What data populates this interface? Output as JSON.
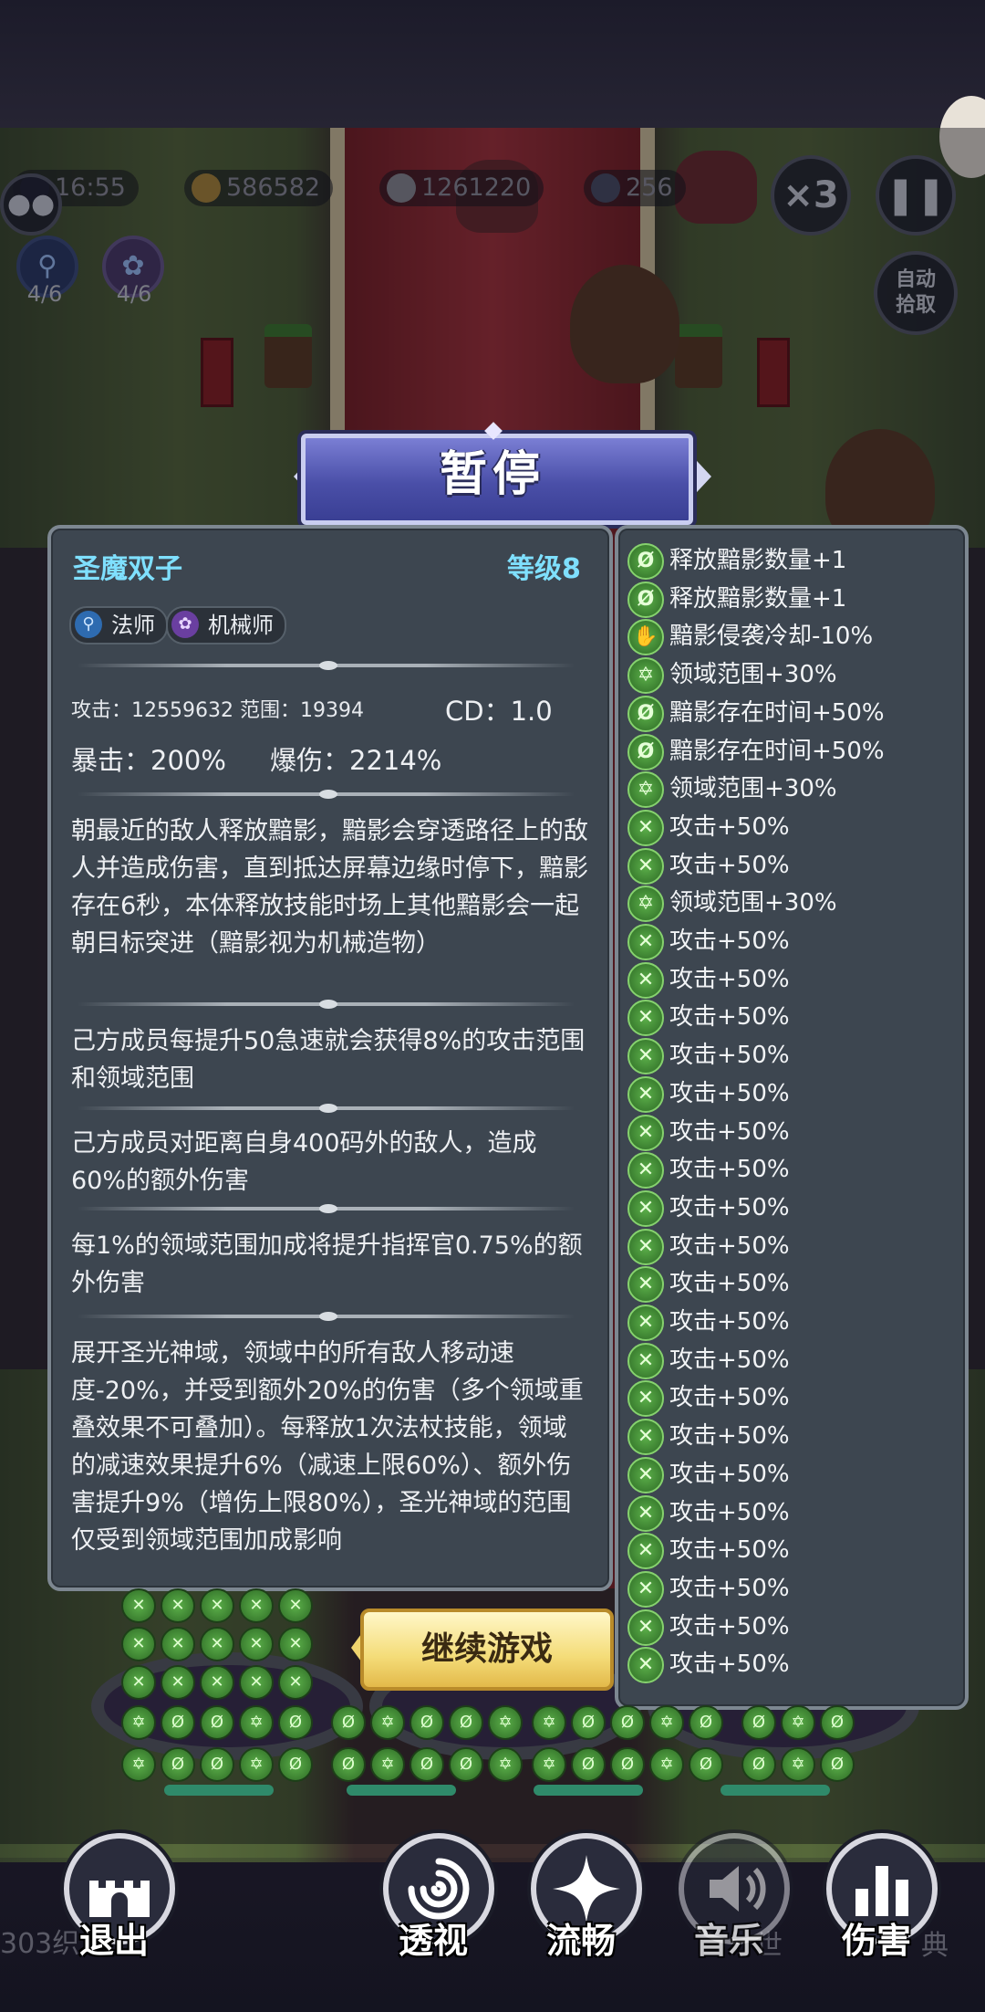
{
  "hud": {
    "timer": "16:55",
    "gold": "586582",
    "kills": "1261220",
    "wave": "256",
    "speed": "×3",
    "auto_pickup": "自动\n拾取",
    "skill_counts": [
      "4/6",
      "4/6"
    ]
  },
  "pause_title": "暂停",
  "hero": {
    "name": "圣魔双子",
    "level": "等级8",
    "tags": [
      {
        "label": "法师",
        "icon": "staff-icon"
      },
      {
        "label": "机械师",
        "icon": "gear-icon"
      }
    ],
    "stats_line1": "攻击：12559632   范围：19394",
    "cd": "CD：1.0",
    "crit": "暴击：200%",
    "crit_dmg": "爆伤：2214%",
    "descriptions": [
      "朝最近的敌人释放黯影，黯影会穿透路径上的敌人并造成伤害，直到抵达屏幕边缘时停下，黯影存在6秒，本体释放技能时场上其他黯影会一起朝目标突进（黯影视为机械造物）",
      "己方成员每提升50急速就会获得8%的攻击范围和领域范围",
      "己方成员对距离自身400码外的敌人，造成60%的额外伤害",
      "每1%的领域范围加成将提升指挥官0.75%的额外伤害",
      "展开圣光神域，领域中的所有敌人移动速度-20%，并受到额外20%的伤害（多个领域重叠效果不可叠加）。每释放1次法杖技能，领域的减速效果提升6%（减速上限60%）、额外伤害提升9%（增伤上限80%），圣光神域的范围仅受到领域范围加成影响"
    ]
  },
  "upgrades": [
    {
      "icon": "shadow-icon",
      "text": "释放黯影数量+1"
    },
    {
      "icon": "shadow-icon",
      "text": "释放黯影数量+1"
    },
    {
      "icon": "hand-icon",
      "text": "黯影侵袭冷却-10%"
    },
    {
      "icon": "star-icon",
      "text": "领域范围+30%"
    },
    {
      "icon": "shadow-icon",
      "text": "黯影存在时间+50%"
    },
    {
      "icon": "shadow-icon",
      "text": "黯影存在时间+50%"
    },
    {
      "icon": "star-icon",
      "text": "领域范围+30%"
    },
    {
      "icon": "swords-icon",
      "text": "攻击+50%"
    },
    {
      "icon": "swords-icon",
      "text": "攻击+50%"
    },
    {
      "icon": "star-icon",
      "text": "领域范围+30%"
    },
    {
      "icon": "swords-icon",
      "text": "攻击+50%"
    },
    {
      "icon": "swords-icon",
      "text": "攻击+50%"
    },
    {
      "icon": "swords-icon",
      "text": "攻击+50%"
    },
    {
      "icon": "swords-icon",
      "text": "攻击+50%"
    },
    {
      "icon": "swords-icon",
      "text": "攻击+50%"
    },
    {
      "icon": "swords-icon",
      "text": "攻击+50%"
    },
    {
      "icon": "swords-icon",
      "text": "攻击+50%"
    },
    {
      "icon": "swords-icon",
      "text": "攻击+50%"
    },
    {
      "icon": "swords-icon",
      "text": "攻击+50%"
    },
    {
      "icon": "swords-icon",
      "text": "攻击+50%"
    },
    {
      "icon": "swords-icon",
      "text": "攻击+50%"
    },
    {
      "icon": "swords-icon",
      "text": "攻击+50%"
    },
    {
      "icon": "swords-icon",
      "text": "攻击+50%"
    },
    {
      "icon": "swords-icon",
      "text": "攻击+50%"
    },
    {
      "icon": "swords-icon",
      "text": "攻击+50%"
    },
    {
      "icon": "swords-icon",
      "text": "攻击+50%"
    },
    {
      "icon": "swords-icon",
      "text": "攻击+50%"
    },
    {
      "icon": "swords-icon",
      "text": "攻击+50%"
    },
    {
      "icon": "swords-icon",
      "text": "攻击+50%"
    },
    {
      "icon": "swords-icon",
      "text": "攻击+50%"
    }
  ],
  "continue_label": "继续游戏",
  "bottom_menu": [
    {
      "label": "退出",
      "icon": "castle-icon"
    },
    {
      "label": "透视",
      "icon": "swirl-icon"
    },
    {
      "label": "流畅",
      "icon": "sparkle-icon"
    },
    {
      "label": "音乐",
      "icon": "speaker-icon"
    },
    {
      "label": "伤害",
      "icon": "bar-chart-icon"
    }
  ],
  "bg_labels": {
    "left": "303织",
    "mid": "世",
    "right": "典"
  },
  "colors": {
    "hero_name": "#7fe0ff",
    "upgrade_icon": "#5cb04a",
    "panel": "#3d4650",
    "continue": "#f4dc78"
  }
}
